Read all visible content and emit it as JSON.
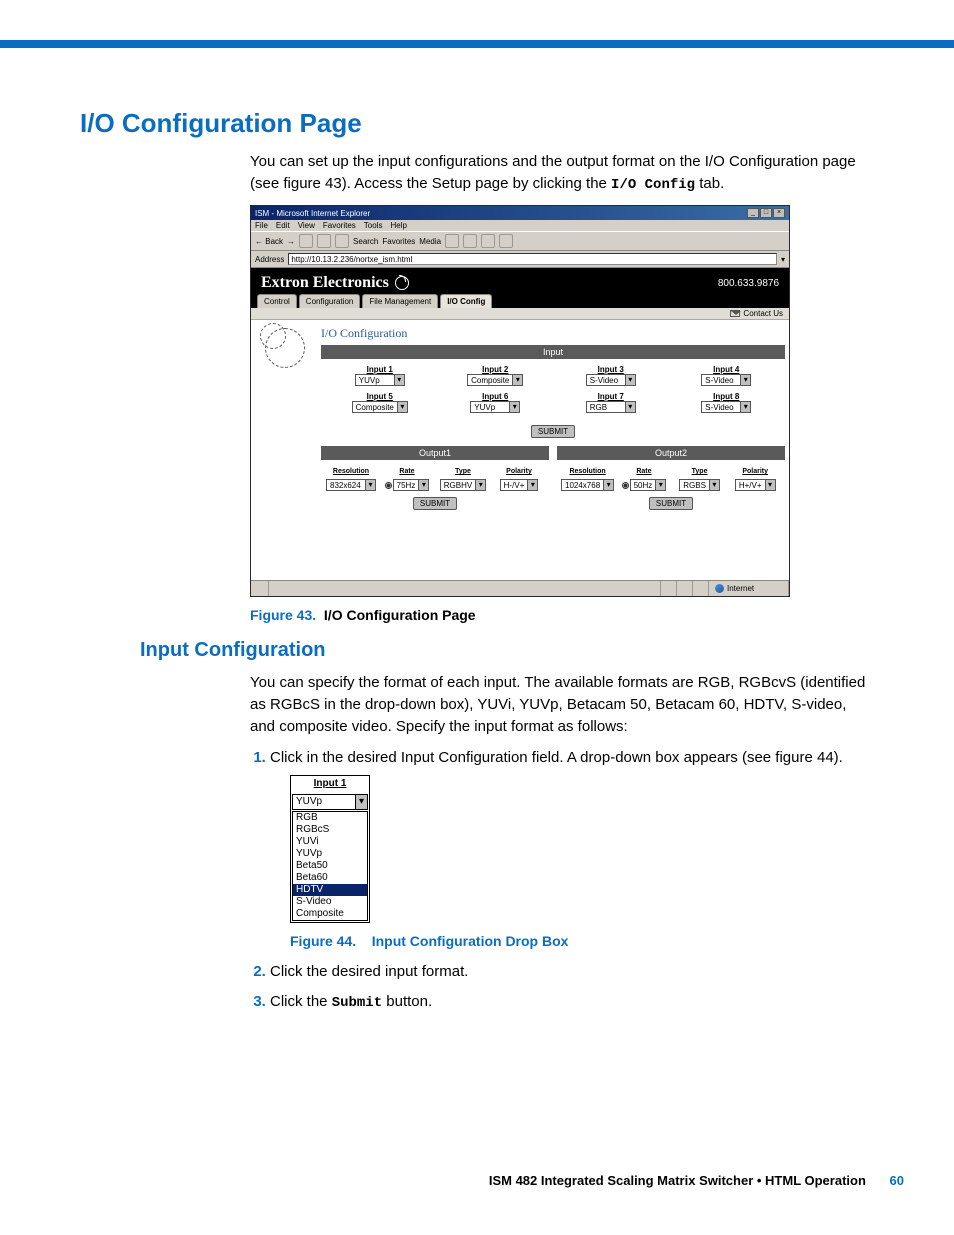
{
  "headings": {
    "main": "I/O Configuration Page",
    "sub": "Input Configuration"
  },
  "paragraphs": {
    "intro_a": "You can set up the input configurations and the output format on the I/O Configuration page (see figure 43).  Access the Setup page by clicking the ",
    "intro_tab": "I/O Config",
    "intro_b": " tab.",
    "input_conf": "You can specify the format of each input.  The available formats are RGB, RGBcvS (identified as RGBcS in the drop-down box), YUVi, YUVp, Betacam 50, Betacam 60, HDTV, S-video, and composite video.  Specify the input format as follows:"
  },
  "captions": {
    "fig43_label": "Figure 43.",
    "fig43_text": "I/O Configuration Page",
    "fig44_label": "Figure 44.",
    "fig44_text": "Input Configuration Drop Box"
  },
  "steps": {
    "s1": "Click in the desired Input Configuration field.  A drop-down box appears (see figure 44).",
    "s2": "Click the desired input format.",
    "s3_a": "Click the ",
    "s3_btn": "Submit",
    "s3_b": " button."
  },
  "browser": {
    "title": "ISM - Microsoft Internet Explorer",
    "menu": {
      "file": "File",
      "edit": "Edit",
      "view": "View",
      "favorites": "Favorites",
      "tools": "Tools",
      "help": "Help"
    },
    "toolbar": {
      "back": "Back",
      "search": "Search",
      "favorites": "Favorites",
      "media": "Media"
    },
    "address_label": "Address",
    "address_value": "http://10.13.2.236/nortxe_ism.html",
    "status_zone": "Internet"
  },
  "webpage": {
    "brand": "Extron   Electronics",
    "phone": "800.633.9876",
    "tabs": {
      "control": "Control",
      "configuration": "Configuration",
      "file_mgmt": "File Management",
      "io": "I/O Config"
    },
    "contact": "Contact Us",
    "panel_title": "I/O Configuration",
    "input_header": "Input",
    "inputs": [
      {
        "label": "Input 1",
        "value": "YUVp"
      },
      {
        "label": "Input 2",
        "value": "Composite"
      },
      {
        "label": "Input 3",
        "value": "S-Video"
      },
      {
        "label": "Input 4",
        "value": "S-Video"
      },
      {
        "label": "Input 5",
        "value": "Composite"
      },
      {
        "label": "Input 6",
        "value": "YUVp"
      },
      {
        "label": "Input 7",
        "value": "RGB"
      },
      {
        "label": "Input 8",
        "value": "S-Video"
      }
    ],
    "submit": "SUBMIT",
    "out1_header": "Output1",
    "out2_header": "Output2",
    "out_cols": {
      "resolution": "Resolution",
      "rate": "Rate",
      "type": "Type",
      "polarity": "Polarity"
    },
    "output1": {
      "resolution": "832x624",
      "rate": "75Hz",
      "type": "RGBHV",
      "polarity": "H-/V+"
    },
    "output2": {
      "resolution": "1024x768",
      "rate": "50Hz",
      "type": "RGBS",
      "polarity": "H+/V+"
    }
  },
  "dropdown": {
    "header": "Input 1",
    "selected": "YUVp",
    "options": [
      "RGB",
      "RGBcS",
      "YUVi",
      "YUVp",
      "Beta50",
      "Beta60",
      "HDTV",
      "S-Video",
      "Composite"
    ],
    "highlighted": "HDTV"
  },
  "footer": {
    "product": "ISM 482 Integrated Scaling Matrix Switcher • HTML Operation",
    "page": "60"
  }
}
